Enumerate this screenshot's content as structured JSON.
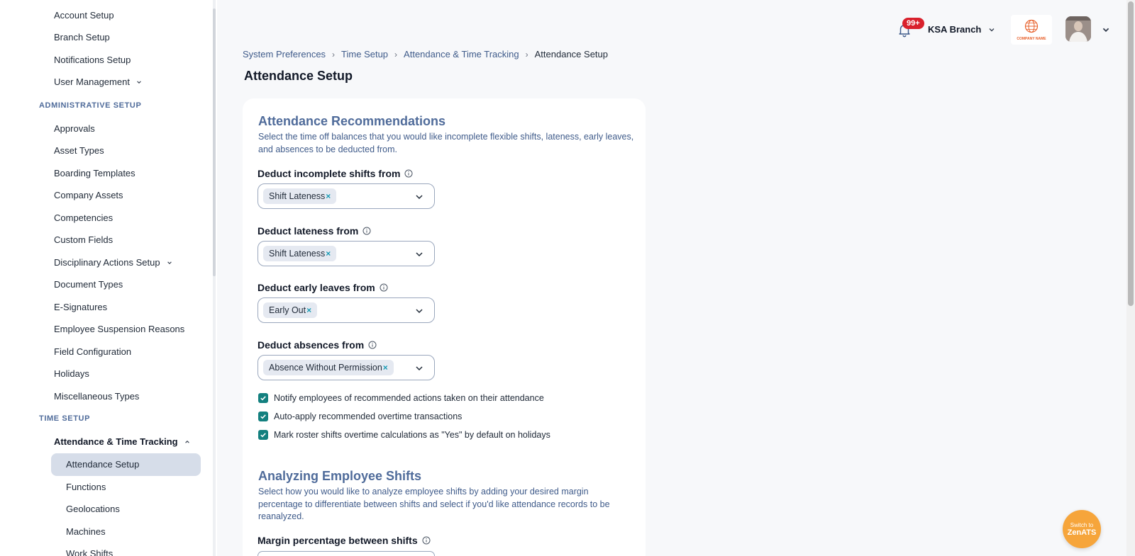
{
  "sidebar": {
    "top_items": [
      "Account Setup",
      "Branch Setup",
      "Notifications Setup",
      "User Management"
    ],
    "administrative_section": "ADMINISTRATIVE SETUP",
    "administrative_items": [
      "Approvals",
      "Asset Types",
      "Boarding Templates",
      "Company Assets",
      "Competencies",
      "Custom Fields",
      "Disciplinary Actions Setup",
      "Document Types",
      "E-Signatures",
      "Employee Suspension Reasons",
      "Field Configuration",
      "Holidays",
      "Miscellaneous Types"
    ],
    "time_section": "TIME SETUP",
    "time_group": "Attendance & Time Tracking",
    "time_subitems": [
      "Attendance Setup",
      "Functions",
      "Geolocations",
      "Machines",
      "Work Shifts"
    ],
    "active_item": "Attendance Setup"
  },
  "header": {
    "notification_count": "99+",
    "branch": "KSA Branch",
    "company_logo_text": "COMPANY NAME"
  },
  "breadcrumb": [
    "System Preferences",
    "Time Setup",
    "Attendance & Time Tracking",
    "Attendance Setup"
  ],
  "page_title": "Attendance Setup",
  "recommendations": {
    "title": "Attendance Recommendations",
    "description": "Select the time off balances that you would like incomplete flexible shifts, lateness, early leaves, and absences to be deducted from.",
    "fields": [
      {
        "label": "Deduct incomplete shifts from",
        "chip": "Shift Lateness"
      },
      {
        "label": "Deduct lateness from",
        "chip": "Shift Lateness"
      },
      {
        "label": "Deduct early leaves from",
        "chip": "Early Out"
      },
      {
        "label": "Deduct absences from",
        "chip": "Absence Without Permission"
      }
    ],
    "checkboxes": [
      "Notify employees of recommended actions taken on their attendance",
      "Auto-apply recommended overtime transactions",
      "Mark roster shifts overtime calculations as \"Yes\" by default on holidays"
    ]
  },
  "analyzing": {
    "title": "Analyzing Employee Shifts",
    "description": "Select how you would like to analyze employee shifts by adding your desired margin percentage to differentiate between shifts and select if you'd like attendance records to be reanalyzed.",
    "margin_label": "Margin percentage between shifts"
  },
  "switch_button": {
    "line1": "Switch to",
    "line2": "ZenATS"
  },
  "colors": {
    "accent": "#4f6b9a",
    "checkbox": "#13807f",
    "badge": "#d9212c",
    "switch_button": "#f6a53b",
    "active_item_bg": "#d6dde9"
  }
}
